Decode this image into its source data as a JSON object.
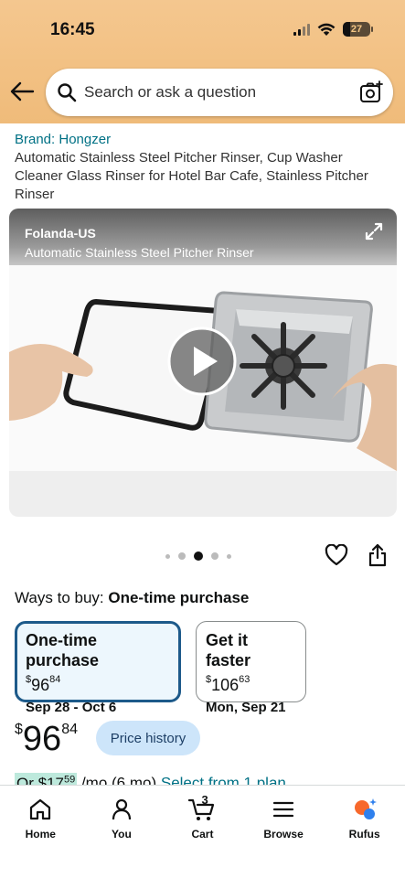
{
  "status_bar": {
    "time": "16:45",
    "battery": "27",
    "battery_level": 0.27
  },
  "search": {
    "placeholder": "Search or ask a question"
  },
  "product": {
    "brand": "Brand: Hongzer",
    "title": "Automatic Stainless Steel Pitcher Rinser, Cup Washer Cleaner Glass Rinser for Hotel Bar Cafe, Stainless Pitcher Rinser"
  },
  "video": {
    "channel": "Folanda-US",
    "caption": "Automatic Stainless Steel Pitcher Rinser"
  },
  "carousel": {
    "count": 5,
    "active_index": 2
  },
  "ways_to_buy": {
    "label": "Ways to buy:",
    "selected": "One-time purchase"
  },
  "options": [
    {
      "title": "One-time purchase",
      "currency": "$",
      "whole": "96",
      "fraction": "84",
      "date": "Sep 28 - Oct 6",
      "selected": true
    },
    {
      "title": "Get it faster",
      "currency": "$",
      "whole": "106",
      "fraction": "63",
      "date": "Mon, Sep 21",
      "selected": false
    }
  ],
  "price": {
    "currency": "$",
    "whole": "96",
    "fraction": "84",
    "history_label": "Price history"
  },
  "installment": {
    "prefix": "Or $17",
    "cents": "59",
    "suffix": " /mo (6 mo) ",
    "link": "Select from 1 plan"
  },
  "bottom_nav": [
    {
      "label": "Home",
      "icon": "home-icon"
    },
    {
      "label": "You",
      "icon": "user-icon"
    },
    {
      "label": "Cart",
      "icon": "cart-icon",
      "count": "3"
    },
    {
      "label": "Browse",
      "icon": "menu-icon"
    },
    {
      "label": "Rufus",
      "icon": "rufus-icon"
    }
  ],
  "colors": {
    "header": "#f2c082",
    "link": "#007185",
    "selected_border": "#1d5a8a",
    "price_history_bg": "#cde5fa"
  }
}
